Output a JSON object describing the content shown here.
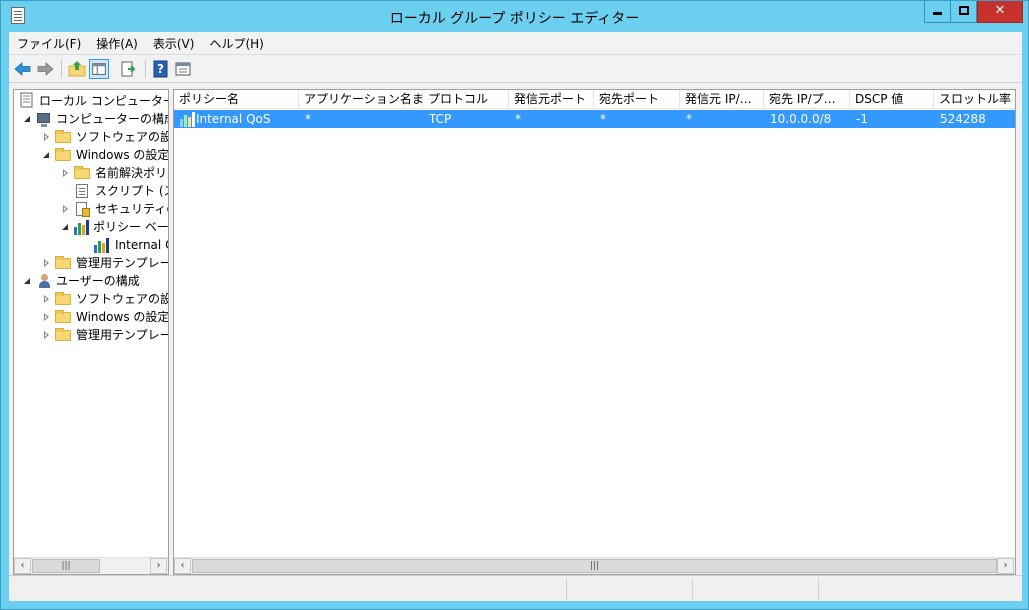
{
  "window": {
    "title": "ローカル グループ ポリシー エディター"
  },
  "menu": [
    {
      "label": "ファイル(F)"
    },
    {
      "label": "操作(A)"
    },
    {
      "label": "表示(V)"
    },
    {
      "label": "ヘルプ(H)"
    }
  ],
  "tree": [
    {
      "label": "ローカル コンピューター ポリシー",
      "icon": "policy-doc-icon",
      "depth": 0
    },
    {
      "label": "コンピューターの構成",
      "icon": "computer-icon",
      "depth": 1,
      "expanded": true
    },
    {
      "label": "ソフトウェアの設定",
      "icon": "folder-icon",
      "depth": 2,
      "expanded": false
    },
    {
      "label": "Windows の設定",
      "icon": "folder-icon",
      "depth": 2,
      "expanded": true
    },
    {
      "label": "名前解決ポリシー",
      "icon": "folder-icon",
      "depth": 3,
      "expanded": false
    },
    {
      "label": "スクリプト (スタートアップ/シャットダウン)",
      "icon": "script-icon",
      "depth": 3
    },
    {
      "label": "セキュリティの設定",
      "icon": "security-icon",
      "depth": 3,
      "expanded": false
    },
    {
      "label": "ポリシー ベースの QoS",
      "icon": "qos-bars-icon",
      "depth": 3,
      "expanded": true
    },
    {
      "label": "Internal QoS",
      "icon": "qos-bars-icon",
      "depth": 4
    },
    {
      "label": "管理用テンプレート",
      "icon": "folder-icon",
      "depth": 2,
      "expanded": false
    },
    {
      "label": "ユーザーの構成",
      "icon": "user-icon",
      "depth": 1,
      "expanded": true
    },
    {
      "label": "ソフトウェアの設定",
      "icon": "folder-icon",
      "depth": 2,
      "expanded": false
    },
    {
      "label": "Windows の設定",
      "icon": "folder-icon",
      "depth": 2,
      "expanded": false
    },
    {
      "label": "管理用テンプレート",
      "icon": "folder-icon",
      "depth": 2,
      "expanded": false
    }
  ],
  "list": {
    "columns": [
      "ポリシー名",
      "アプリケーション名また…",
      "プロトコル",
      "発信元ポート",
      "宛先ポート",
      "発信元 IP/…",
      "宛先 IP/プ…",
      "DSCP 値",
      "スロットル率"
    ],
    "rows": [
      [
        "Internal QoS",
        "*",
        "TCP",
        "*",
        "*",
        "*",
        "10.0.0.0/8",
        "-1",
        "524288"
      ]
    ]
  },
  "colors": {
    "titlebar": "#6bcff0",
    "selection": "#3399ff",
    "close": "#c7312b"
  }
}
